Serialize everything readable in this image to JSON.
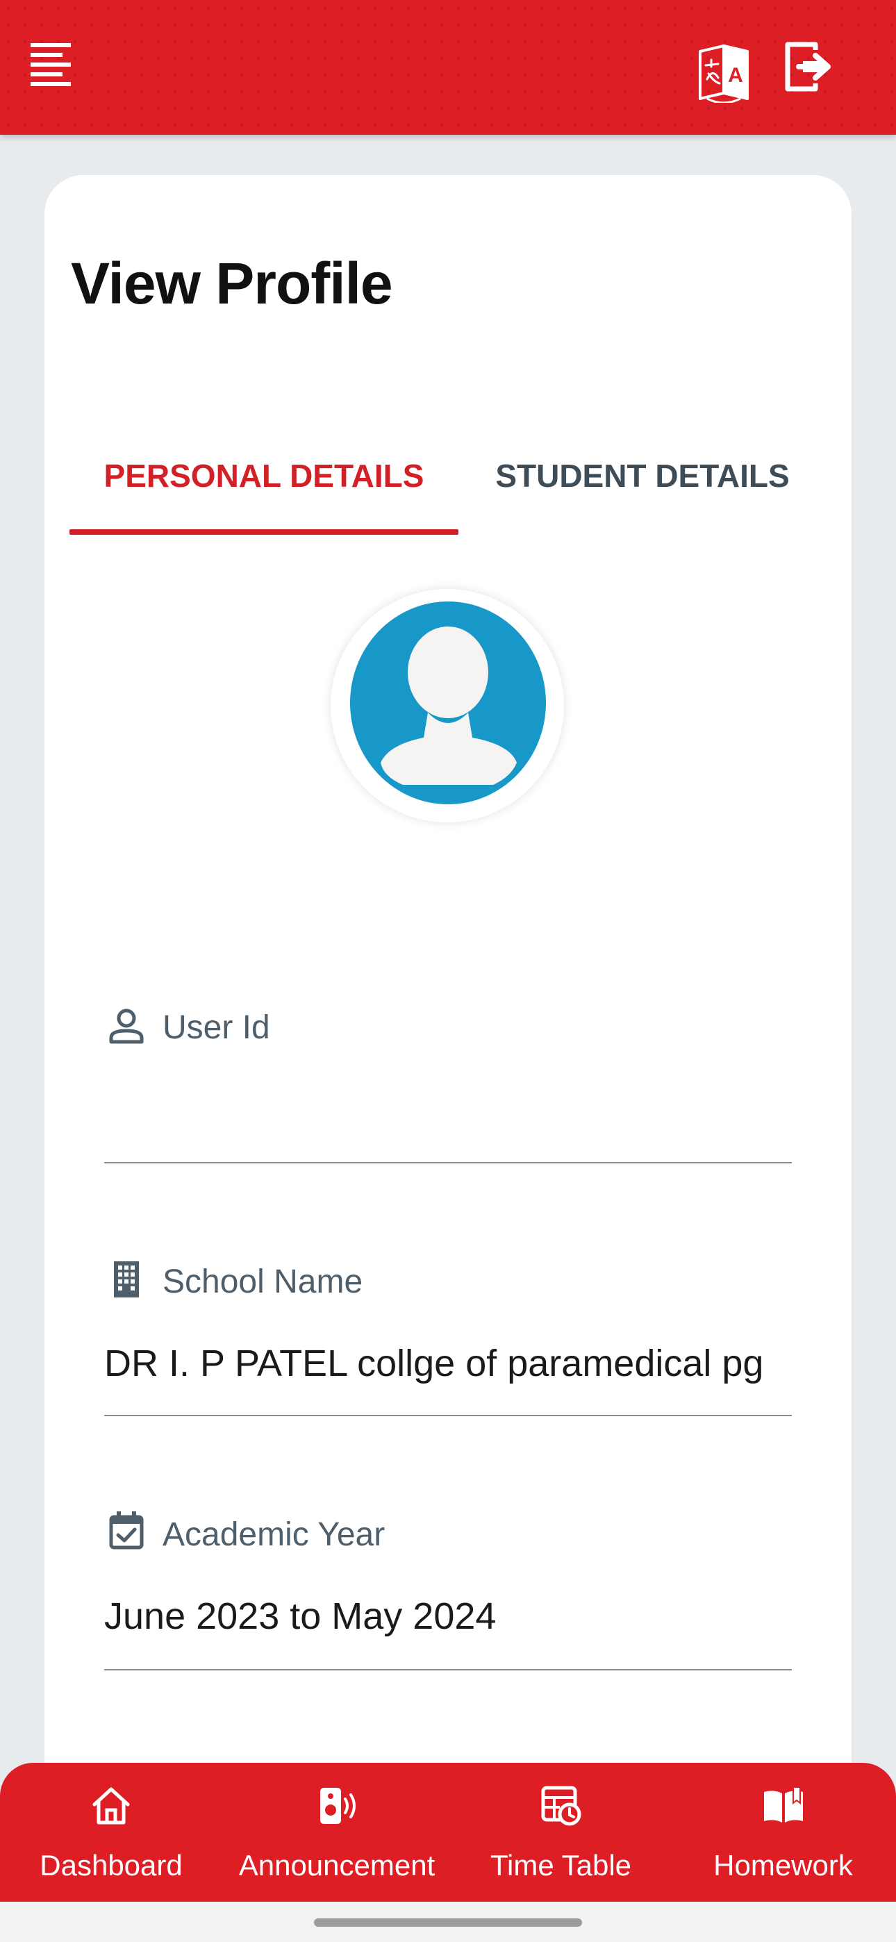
{
  "header": {
    "menu_icon": "menu-icon",
    "translate_icon": "translate-icon",
    "logout_icon": "logout-icon",
    "background_color": "#dd1e25"
  },
  "page": {
    "title": "View Profile"
  },
  "tabs": [
    {
      "label": "PERSONAL DETAILS",
      "active": true
    },
    {
      "label": "STUDENT DETAILS",
      "active": false
    }
  ],
  "avatar": {
    "icon": "user-avatar-icon",
    "color": "#1897c9"
  },
  "fields": [
    {
      "label": "User Id",
      "value": "",
      "icon": "person-icon"
    },
    {
      "label": "School Name",
      "value": "DR I. P PATEL collge of paramedical pg",
      "icon": "building-icon"
    },
    {
      "label": "Academic Year",
      "value": "June 2023 to May 2024",
      "icon": "calendar-check-icon"
    }
  ],
  "bottom_nav": [
    {
      "label": "Dashboard",
      "icon": "home-icon"
    },
    {
      "label": "Announcement",
      "icon": "speaker-icon"
    },
    {
      "label": "Time Table",
      "icon": "timetable-icon"
    },
    {
      "label": "Homework",
      "icon": "book-icon"
    }
  ],
  "colors": {
    "accent": "#d22027",
    "tab_inactive": "#3d4c56",
    "label": "#4e5e6a"
  }
}
